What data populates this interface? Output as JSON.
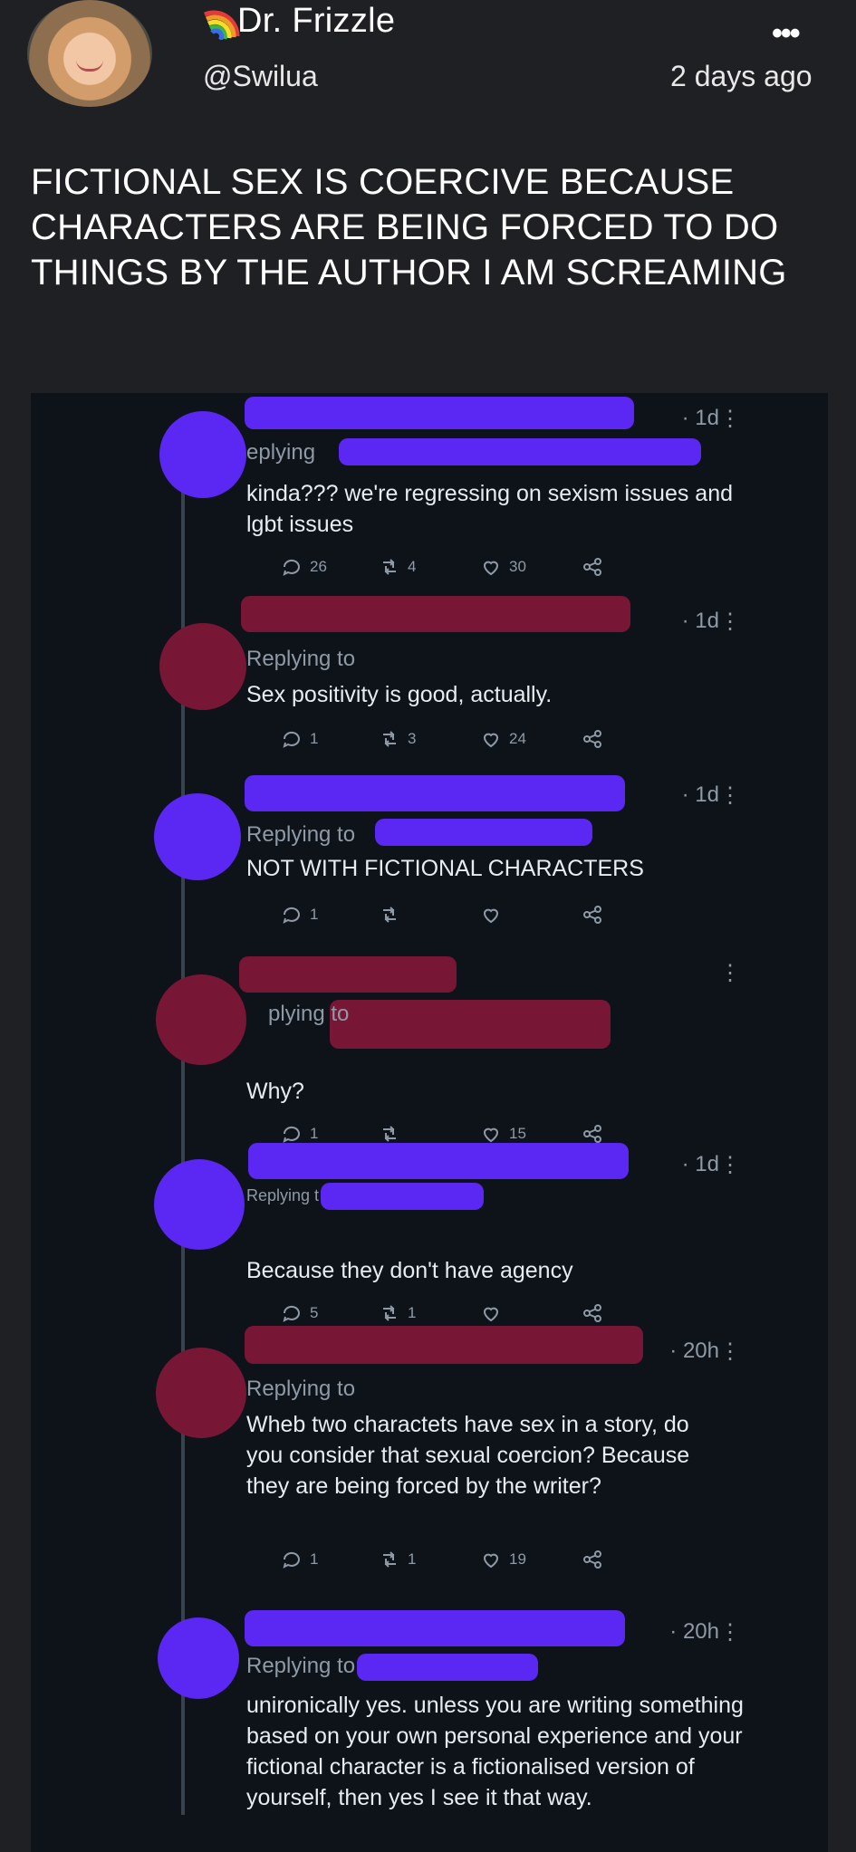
{
  "post": {
    "display_name": "Dr. Frizzle",
    "handle": "@Swilua",
    "timestamp": "2 days ago",
    "text": "FICTIONAL SEX IS COERCIVE BECAUSE CHARACTERS ARE BEING FORCED TO DO THINGS BY THE AUTHOR I AM SCREAMING"
  },
  "icons": {
    "more": "more-options-icon",
    "flag": "rainbow-flag-icon"
  },
  "embed": {
    "tweets": [
      {
        "time": "· 1d",
        "replying": "eplying",
        "body": "kinda??? we're regressing on sexism issues and lgbt issues",
        "replies": "26",
        "retweets": "4",
        "likes": "30"
      },
      {
        "time": "· 1d",
        "replying": "Replying to",
        "body": "Sex positivity is good, actually.",
        "replies": "1",
        "retweets": "3",
        "likes": "24"
      },
      {
        "time": "· 1d",
        "replying": "Replying to",
        "body": "NOT WITH FICTIONAL CHARACTERS",
        "replies": "1",
        "retweets": "",
        "likes": ""
      },
      {
        "time": "",
        "replying": "plying to",
        "body": "Why?",
        "replies": "1",
        "retweets": "",
        "likes": "15"
      },
      {
        "time": "· 1d",
        "replying": "Replying t",
        "body": "Because they don't have agency",
        "replies": "5",
        "retweets": "1",
        "likes": ""
      },
      {
        "time": "· 20h",
        "replying": "Replying to",
        "body": "Wheb two charactets have sex in a story, do you consider that sexual coercion? Because they are being forced by the writer?",
        "replies": "1",
        "retweets": "1",
        "likes": "19"
      },
      {
        "time": "· 20h",
        "replying": "Replying to",
        "body": "unironically yes. unless you are writing something based on your own personal experience and your fictional character is a fictionalised version of yourself, then yes I see it that way.",
        "replies": "",
        "retweets": "",
        "likes": ""
      }
    ]
  }
}
